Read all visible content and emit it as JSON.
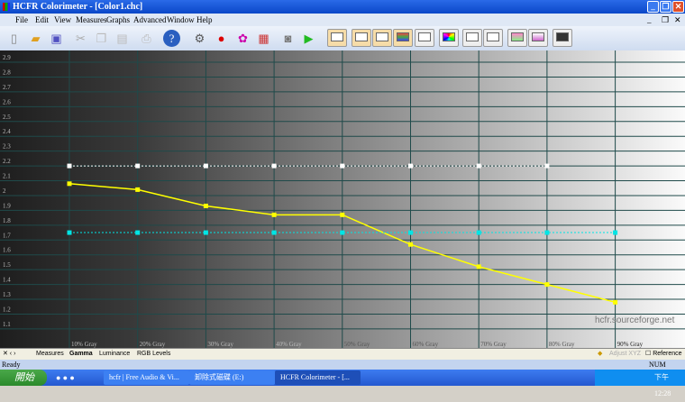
{
  "window": {
    "title": "HCFR Colorimeter - [Color1.chc]"
  },
  "menu": [
    "File",
    "Edit",
    "View",
    "Measures",
    "Graphs",
    "Advanced",
    "Window",
    "Help"
  ],
  "toolbar_icons": [
    "new-icon",
    "open-icon",
    "save-icon",
    "cut-icon",
    "copy-icon",
    "paste-icon",
    "print-icon",
    "help-icon",
    "sensor-icon",
    "rgb-icon",
    "colors-icon",
    "patterns-icon",
    "camera-icon",
    "play-icon"
  ],
  "view_icons": [
    "measures-view",
    "gamma-view",
    "luminance-view",
    "rgb-levels-view",
    "cie-view",
    "color-space-view",
    "saturation-view",
    "saturation2-view",
    "color-temp-view",
    "delta-e-view",
    "contrast-view"
  ],
  "chart_data": {
    "type": "line",
    "categories": [
      "10% Gray",
      "20% Gray",
      "30% Gray",
      "40% Gray",
      "50% Gray",
      "60% Gray",
      "70% Gray",
      "80% Gray",
      "90% Gray"
    ],
    "ylim": [
      1.0,
      2.95
    ],
    "yticks": [
      "2.9",
      "2.8",
      "2.7",
      "2.6",
      "2.5",
      "2.4",
      "2.3",
      "2.2",
      "2.1",
      "2",
      "1.9",
      "1.8",
      "1.7",
      "1.6",
      "1.5",
      "1.4",
      "1.3",
      "1.2",
      "1.1"
    ],
    "grid": true,
    "series": [
      {
        "values": [
          2.08,
          2.04,
          1.93,
          1.87,
          1.87,
          1.67,
          1.52,
          1.4,
          1.28
        ],
        "color": "#ffff00",
        "style": "solid"
      },
      {
        "values": [
          2.2,
          2.2,
          2.2,
          2.2,
          2.2,
          2.2,
          2.2,
          2.2,
          null
        ],
        "color": "#ffffff",
        "style": "dotted"
      },
      {
        "values": [
          1.75,
          1.75,
          1.75,
          1.75,
          1.75,
          1.75,
          1.75,
          1.75,
          1.75
        ],
        "color": "#00e5e5",
        "style": "dotted"
      }
    ],
    "watermark": "hcfr.sourceforge.net"
  },
  "tabs": [
    "Measures",
    "Gamma",
    "Luminance",
    "RGB Levels"
  ],
  "active_tab": "Gamma",
  "bottom_controls": {
    "adjust": "Adjust XYZ",
    "reference": "Reference"
  },
  "status": {
    "text": "Ready",
    "num": "NUM"
  },
  "taskbar": {
    "start": "開始",
    "tasks": [
      "hcfr | Free Audio & Vi...",
      "卸除式磁碟 (E:)",
      "HCFR Colorimeter - [..."
    ],
    "clock": "下午 12:28"
  }
}
